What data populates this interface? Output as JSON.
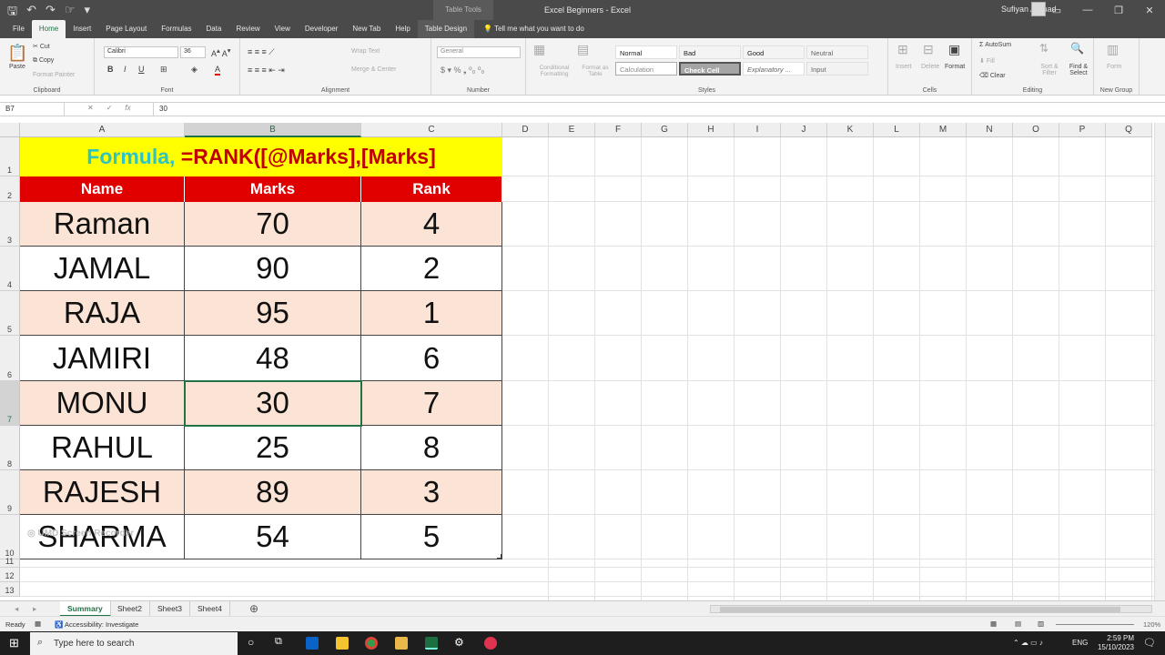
{
  "window": {
    "context_tab_group": "Table Tools",
    "title": "Excel Beginners  -  Excel",
    "user": "Sufiyan Ahmad"
  },
  "ribbon_tabs": [
    "File",
    "Home",
    "Insert",
    "Page Layout",
    "Formulas",
    "Data",
    "Review",
    "View",
    "Developer",
    "New Tab",
    "Help",
    "Table Design"
  ],
  "tell_me": "Tell me what you want to do",
  "ribbon": {
    "clipboard": {
      "paste": "Paste",
      "cut": "Cut",
      "copy": "Copy",
      "format_painter": "Format Painter",
      "label": "Clipboard"
    },
    "font": {
      "name": "Calibri",
      "size": "36",
      "label": "Font"
    },
    "alignment": {
      "wrap": "Wrap Text",
      "merge": "Merge & Center",
      "label": "Alignment"
    },
    "number": {
      "format": "General",
      "label": "Number"
    },
    "styles": {
      "conditional": "Conditional Formatting",
      "format_table": "Format as Table",
      "cells": [
        "Normal",
        "Bad",
        "Good",
        "Neutral",
        "Calculation",
        "Check Cell",
        "Explanatory ...",
        "Input"
      ],
      "label": "Styles"
    },
    "cells": {
      "insert": "Insert",
      "delete": "Delete",
      "format": "Format",
      "label": "Cells"
    },
    "editing": {
      "autosum": "AutoSum",
      "fill": "Fill",
      "clear": "Clear",
      "sort": "Sort & Filter",
      "find": "Find & Select",
      "label": "Editing"
    },
    "new_group": {
      "form": "Form",
      "label": "New Group"
    }
  },
  "formula_bar": {
    "name_box": "B7",
    "value": "30"
  },
  "columns": [
    "A",
    "B",
    "C",
    "D",
    "E",
    "F",
    "G",
    "H",
    "I",
    "J",
    "K",
    "L",
    "M",
    "N",
    "O",
    "P",
    "Q"
  ],
  "rows": [
    "1",
    "2",
    "3",
    "4",
    "5",
    "6",
    "7",
    "8",
    "9",
    "10",
    "11",
    "12",
    "13"
  ],
  "sheet": {
    "title_part1": "Formula, ",
    "title_part2": "=RANK([@Marks],[Marks]",
    "headers": [
      "Name",
      "Marks",
      "Rank"
    ],
    "data": [
      {
        "name": "Raman",
        "marks": "70",
        "rank": "4"
      },
      {
        "name": "JAMAL",
        "marks": "90",
        "rank": "2"
      },
      {
        "name": "RAJA",
        "marks": "95",
        "rank": "1"
      },
      {
        "name": "JAMIRI",
        "marks": "48",
        "rank": "6"
      },
      {
        "name": "MONU",
        "marks": "30",
        "rank": "7"
      },
      {
        "name": "RAHUL",
        "marks": "25",
        "rank": "8"
      },
      {
        "name": "RAJESH",
        "marks": "89",
        "rank": "3"
      },
      {
        "name": "SHARMA",
        "marks": "54",
        "rank": "5"
      }
    ]
  },
  "watermark": "UMD Screen Recorder",
  "sheet_tabs": [
    "Summary",
    "Sheet2",
    "Sheet3",
    "Sheet4"
  ],
  "status": {
    "ready": "Ready",
    "accessibility": "Accessibility: Investigate",
    "zoom": "120%"
  },
  "taskbar": {
    "search_placeholder": "Type here to search",
    "lang": "ENG",
    "time": "2:59 PM",
    "date": "15/10/2023"
  },
  "colors": {
    "header_red": "#e00000",
    "title_yellow": "#ffff00",
    "row_peach": "#fbe4d5",
    "excel_green": "#217346"
  }
}
